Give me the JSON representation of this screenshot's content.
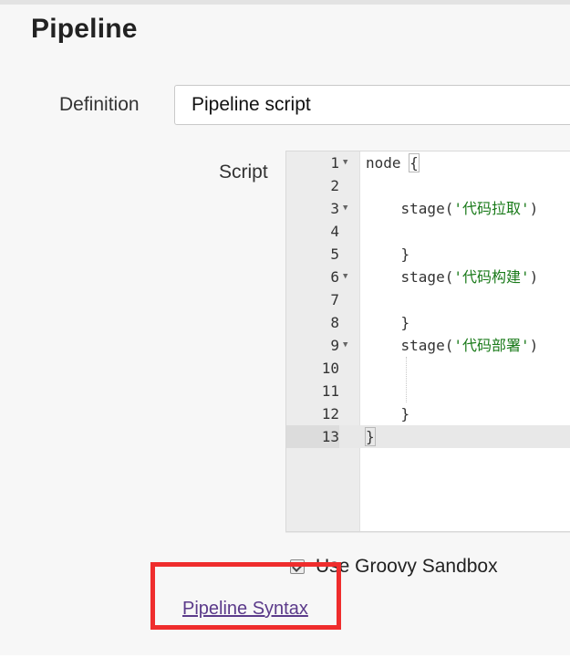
{
  "section": {
    "title": "Pipeline"
  },
  "definition": {
    "label": "Definition",
    "selected": "Pipeline script"
  },
  "script": {
    "label": "Script",
    "lines": [
      {
        "num": "1",
        "fold": true,
        "text": "node {"
      },
      {
        "num": "2",
        "fold": false,
        "text": ""
      },
      {
        "num": "3",
        "fold": true,
        "pre": "    stage(",
        "str": "'代码拉取'",
        "post": ")"
      },
      {
        "num": "4",
        "fold": false,
        "text": ""
      },
      {
        "num": "5",
        "fold": false,
        "text": "    }"
      },
      {
        "num": "6",
        "fold": true,
        "pre": "    stage(",
        "str": "'代码构建'",
        "post": ")"
      },
      {
        "num": "7",
        "fold": false,
        "text": ""
      },
      {
        "num": "8",
        "fold": false,
        "text": "    }"
      },
      {
        "num": "9",
        "fold": true,
        "pre": "    stage(",
        "str": "'代码部署'",
        "post": ")"
      },
      {
        "num": "10",
        "fold": false,
        "text": ""
      },
      {
        "num": "11",
        "fold": false,
        "text": ""
      },
      {
        "num": "12",
        "fold": false,
        "text": "    }"
      },
      {
        "num": "13",
        "fold": false,
        "text": "}"
      }
    ]
  },
  "sandbox": {
    "label": "Use Groovy Sandbox",
    "checked": true
  },
  "links": {
    "pipeline_syntax": "Pipeline Syntax"
  },
  "annotation": {
    "color": "#ef2d2d"
  }
}
